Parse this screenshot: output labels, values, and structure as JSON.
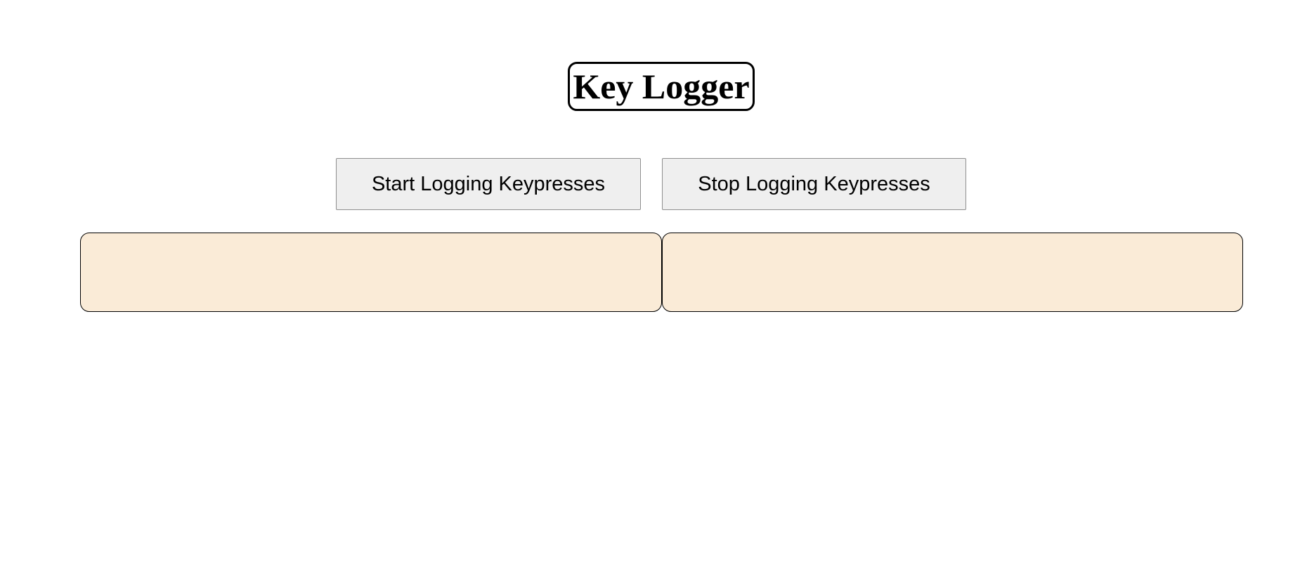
{
  "page": {
    "title": "Key Logger"
  },
  "controls": {
    "start_label": "Start Logging Keypresses",
    "stop_label": "Stop Logging Keypresses"
  },
  "log_panels": {
    "left_text": "",
    "right_text": ""
  },
  "colors": {
    "panel_background": "#faebd7",
    "button_background": "#efefef"
  }
}
